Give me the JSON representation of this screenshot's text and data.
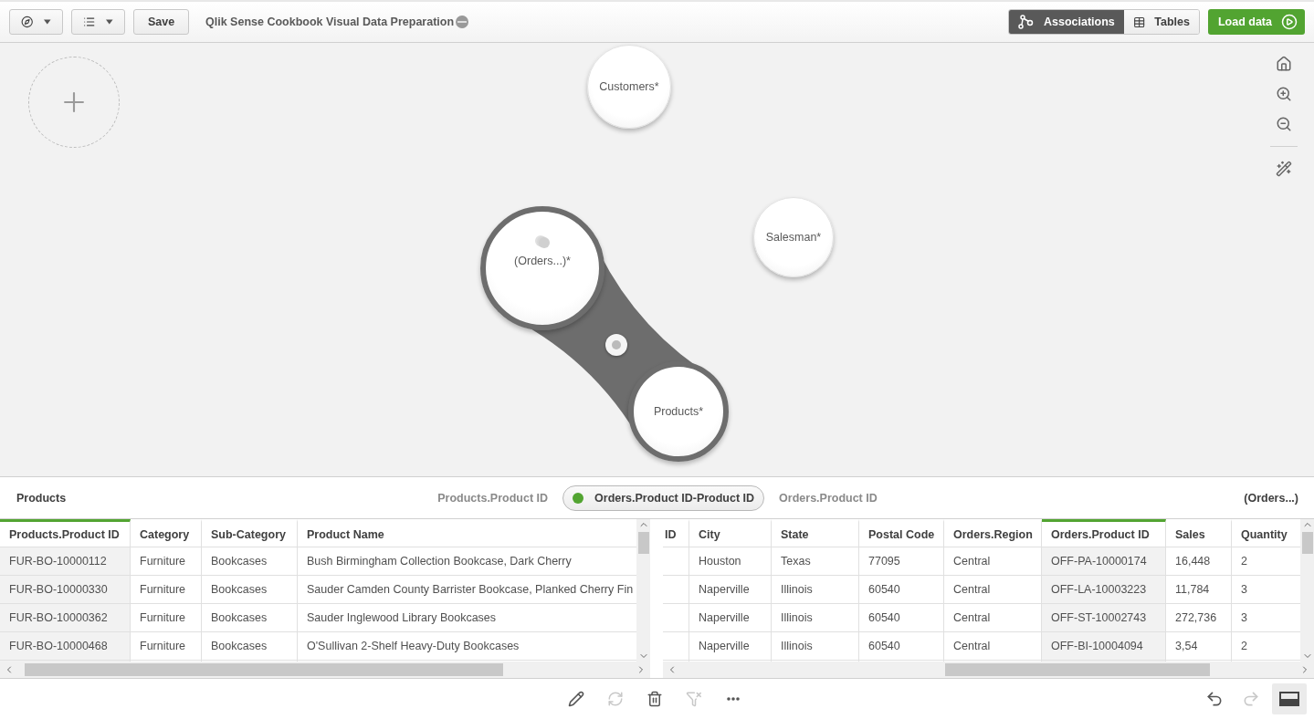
{
  "toolbar": {
    "title": "Qlik Sense Cookbook Visual Data Preparation",
    "save": "Save",
    "views": [
      {
        "label": "Associations",
        "selected": true
      },
      {
        "label": "Tables",
        "selected": false
      }
    ],
    "load": "Load data"
  },
  "canvas": {
    "tables": [
      {
        "name": "Customers*",
        "selected": false,
        "concatenated": false
      },
      {
        "name": "Salesman*",
        "selected": false,
        "concatenated": false
      },
      {
        "name": "(Orders...)*",
        "selected": true,
        "concatenated": true
      },
      {
        "name": "Products*",
        "selected": true,
        "concatenated": false
      }
    ]
  },
  "association_bar": {
    "left_table": "Products",
    "left_field": "Products.Product ID",
    "association": "Orders.Product ID-Product ID",
    "right_field": "Orders.Product ID",
    "right_table": "(Orders...)"
  },
  "tables": [
    {
      "columns": [
        {
          "label": "Products.Product ID",
          "highlighted": true
        },
        {
          "label": "Category",
          "highlighted": false
        },
        {
          "label": "Sub-Category",
          "highlighted": false
        },
        {
          "label": "Product Name",
          "highlighted": false
        }
      ],
      "rows": [
        [
          "FUR-BO-10000112",
          "Furniture",
          "Bookcases",
          "Bush Birmingham Collection Bookcase, Dark Cherry"
        ],
        [
          "FUR-BO-10000330",
          "Furniture",
          "Bookcases",
          "Sauder Camden County Barrister Bookcase, Planked Cherry Fin"
        ],
        [
          "FUR-BO-10000362",
          "Furniture",
          "Bookcases",
          "Sauder Inglewood Library Bookcases"
        ],
        [
          "FUR-BO-10000468",
          "Furniture",
          "Bookcases",
          "O'Sullivan 2-Shelf Heavy-Duty Bookcases"
        ]
      ]
    },
    {
      "columns": [
        {
          "label": "ID",
          "highlighted": false
        },
        {
          "label": "City",
          "highlighted": false
        },
        {
          "label": "State",
          "highlighted": false
        },
        {
          "label": "Postal Code",
          "highlighted": false
        },
        {
          "label": "Orders.Region",
          "highlighted": false
        },
        {
          "label": "Orders.Product ID",
          "highlighted": true
        },
        {
          "label": "Sales",
          "highlighted": false
        },
        {
          "label": "Quantity",
          "highlighted": false
        }
      ],
      "rows": [
        [
          "",
          "Houston",
          "Texas",
          "77095",
          "Central",
          "OFF-PA-10000174",
          "16,448",
          "2"
        ],
        [
          "",
          "Naperville",
          "Illinois",
          "60540",
          "Central",
          "OFF-LA-10003223",
          "11,784",
          "3"
        ],
        [
          "",
          "Naperville",
          "Illinois",
          "60540",
          "Central",
          "OFF-ST-10002743",
          "272,736",
          "3"
        ],
        [
          "",
          "Naperville",
          "Illinois",
          "60540",
          "Central",
          "OFF-BI-10004094",
          "3,54",
          "2"
        ]
      ]
    }
  ],
  "bottom_tools": [
    {
      "kind": "edit",
      "disabled": false
    },
    {
      "kind": "reload",
      "disabled": true
    },
    {
      "kind": "delete",
      "disabled": false
    },
    {
      "kind": "filter",
      "disabled": true
    },
    {
      "kind": "more",
      "disabled": false
    }
  ],
  "history": [
    {
      "kind": "undo",
      "disabled": false
    },
    {
      "kind": "redo",
      "disabled": true
    }
  ],
  "panel_toggle": {
    "selected": true
  }
}
